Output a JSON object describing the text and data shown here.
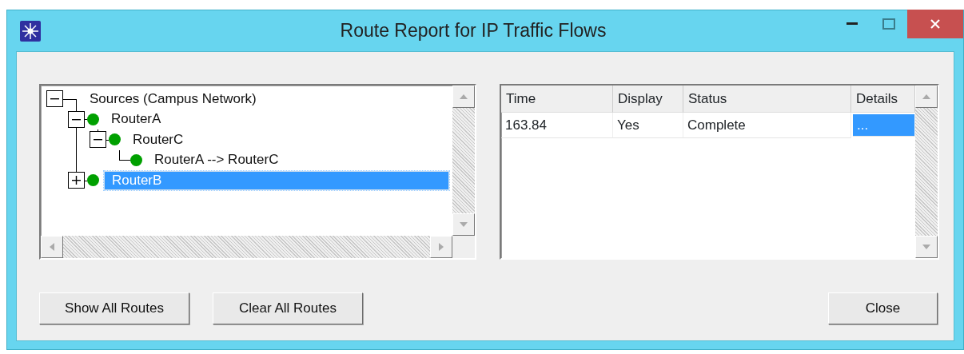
{
  "window": {
    "title": "Route Report for IP Traffic Flows"
  },
  "tree": [
    {
      "label": "Sources (Campus Network)",
      "kind": "root",
      "expanded": true,
      "selected": false,
      "children": [
        {
          "label": "RouterA",
          "kind": "node",
          "expanded": true,
          "selected": false,
          "children": [
            {
              "label": "RouterC",
              "kind": "node",
              "expanded": true,
              "selected": false,
              "children": [
                {
                  "label": "RouterA --> RouterC",
                  "kind": "node",
                  "selected": false
                }
              ]
            }
          ]
        },
        {
          "label": "RouterB",
          "kind": "node",
          "expanded": false,
          "selected": true
        }
      ]
    }
  ],
  "table": {
    "columns": [
      "Time",
      "Display",
      "Status",
      "Details"
    ],
    "rows": [
      {
        "cells": [
          {
            "text": "163.84",
            "selected": false
          },
          {
            "text": "Yes",
            "selected": false
          },
          {
            "text": "Complete",
            "selected": false
          },
          {
            "text": "...",
            "selected": true
          }
        ]
      }
    ]
  },
  "buttons": [
    {
      "label": "Show All Routes"
    },
    {
      "label": "Clear All Routes"
    }
  ],
  "close_button": {
    "label": "Close"
  }
}
